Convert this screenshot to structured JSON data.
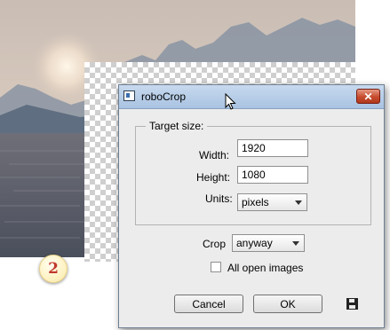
{
  "dialog": {
    "title": "roboCrop",
    "close_symbol": "✕",
    "target_size_legend": "Target size:",
    "width_label": "Width:",
    "width_value": "1920",
    "height_label": "Height:",
    "height_value": "1080",
    "units_label": "Units:",
    "units_value": "pixels",
    "crop_label": "Crop",
    "crop_value": "anyway",
    "all_open_images_label": "All open images",
    "all_open_images_checked": false,
    "cancel_label": "Cancel",
    "ok_label": "OK"
  },
  "step_badge": "2",
  "icons": {
    "app": "app-window-icon",
    "close": "close-icon",
    "save": "floppy-disk-icon",
    "cursor": "mouse-pointer-icon"
  },
  "colors": {
    "titlebar": "#b6cce8",
    "close_button": "#c74b2e",
    "dialog_bg": "#ececec",
    "badge_text": "#c0392b"
  }
}
